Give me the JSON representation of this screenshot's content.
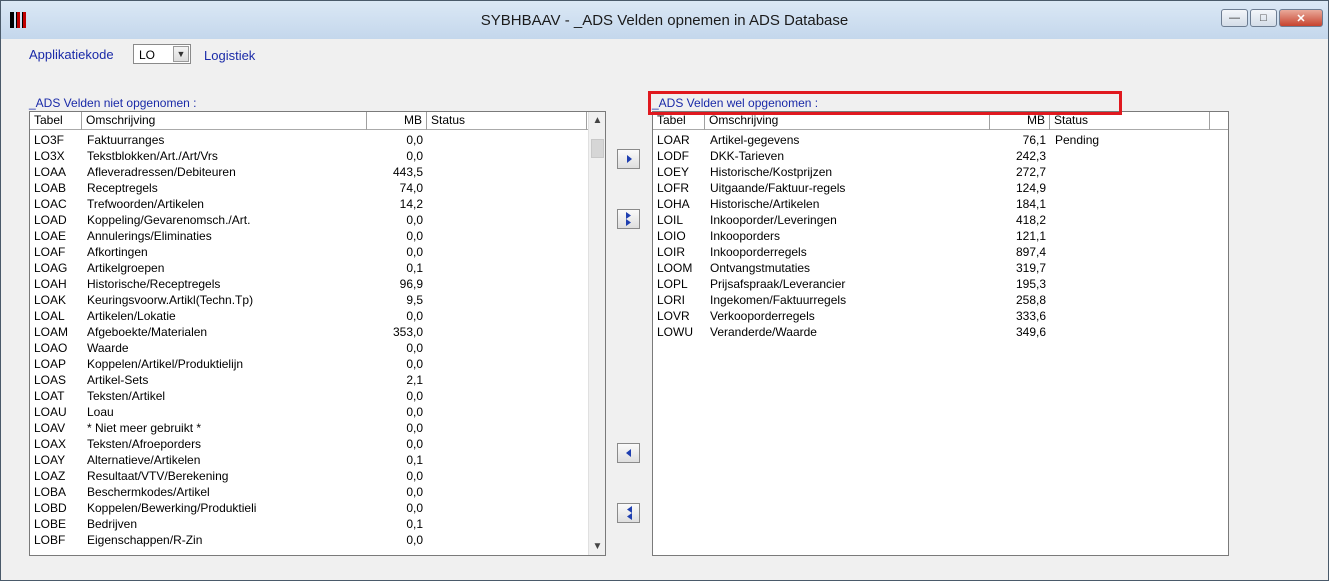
{
  "window": {
    "title": "SYBHBAAV - _ADS Velden opnemen in ADS Database",
    "minimize": "—",
    "maximize": "□",
    "close": "✕"
  },
  "app": {
    "label": "Applikatiekode",
    "code_value": "LO",
    "description": "Logistiek"
  },
  "left": {
    "group_label": "_ADS Velden niet opgenomen :",
    "columns": {
      "tabel": "Tabel",
      "omschrijving": "Omschrijving",
      "mb": "MB",
      "status": "Status"
    },
    "rows": [
      {
        "tabel": "LO3F",
        "oms": "Faktuurranges",
        "mb": "0,0",
        "status": ""
      },
      {
        "tabel": "LO3X",
        "oms": "Tekstblokken/Art./Art/Vrs",
        "mb": "0,0",
        "status": ""
      },
      {
        "tabel": "LOAA",
        "oms": "Afleveradressen/Debiteuren",
        "mb": "443,5",
        "status": ""
      },
      {
        "tabel": "LOAB",
        "oms": "Receptregels",
        "mb": "74,0",
        "status": ""
      },
      {
        "tabel": "LOAC",
        "oms": "Trefwoorden/Artikelen",
        "mb": "14,2",
        "status": ""
      },
      {
        "tabel": "LOAD",
        "oms": "Koppeling/Gevarenomsch./Art.",
        "mb": "0,0",
        "status": ""
      },
      {
        "tabel": "LOAE",
        "oms": "Annulerings/Eliminaties",
        "mb": "0,0",
        "status": ""
      },
      {
        "tabel": "LOAF",
        "oms": "Afkortingen",
        "mb": "0,0",
        "status": ""
      },
      {
        "tabel": "LOAG",
        "oms": "Artikelgroepen",
        "mb": "0,1",
        "status": ""
      },
      {
        "tabel": "LOAH",
        "oms": "Historische/Receptregels",
        "mb": "96,9",
        "status": ""
      },
      {
        "tabel": "LOAK",
        "oms": "Keuringsvoorw.Artikl(Techn.Tp)",
        "mb": "9,5",
        "status": ""
      },
      {
        "tabel": "LOAL",
        "oms": "Artikelen/Lokatie",
        "mb": "0,0",
        "status": ""
      },
      {
        "tabel": "LOAM",
        "oms": "Afgeboekte/Materialen",
        "mb": "353,0",
        "status": ""
      },
      {
        "tabel": "LOAO",
        "oms": "Waarde",
        "mb": "0,0",
        "status": ""
      },
      {
        "tabel": "LOAP",
        "oms": "Koppelen/Artikel/Produktielijn",
        "mb": "0,0",
        "status": ""
      },
      {
        "tabel": "LOAS",
        "oms": "Artikel-Sets",
        "mb": "2,1",
        "status": ""
      },
      {
        "tabel": "LOAT",
        "oms": "Teksten/Artikel",
        "mb": "0,0",
        "status": ""
      },
      {
        "tabel": "LOAU",
        "oms": "Loau",
        "mb": "0,0",
        "status": ""
      },
      {
        "tabel": "LOAV",
        "oms": "* Niet meer gebruikt *",
        "mb": "0,0",
        "status": ""
      },
      {
        "tabel": "LOAX",
        "oms": "Teksten/Afroeporders",
        "mb": "0,0",
        "status": ""
      },
      {
        "tabel": "LOAY",
        "oms": "Alternatieve/Artikelen",
        "mb": "0,1",
        "status": ""
      },
      {
        "tabel": "LOAZ",
        "oms": "Resultaat/VTV/Berekening",
        "mb": "0,0",
        "status": ""
      },
      {
        "tabel": "LOBA",
        "oms": "Beschermkodes/Artikel",
        "mb": "0,0",
        "status": ""
      },
      {
        "tabel": "LOBD",
        "oms": "Koppelen/Bewerking/Produktieli",
        "mb": "0,0",
        "status": ""
      },
      {
        "tabel": "LOBE",
        "oms": "Bedrijven",
        "mb": "0,1",
        "status": ""
      },
      {
        "tabel": "LOBF",
        "oms": "Eigenschappen/R-Zin",
        "mb": "0,0",
        "status": ""
      }
    ]
  },
  "right": {
    "group_label": "_ADS Velden wel opgenomen :",
    "columns": {
      "tabel": "Tabel",
      "omschrijving": "Omschrijving",
      "mb": "MB",
      "status": "Status"
    },
    "rows": [
      {
        "tabel": "LOAR",
        "oms": "Artikel-gegevens",
        "mb": "76,1",
        "status": "Pending"
      },
      {
        "tabel": "LODF",
        "oms": "DKK-Tarieven",
        "mb": "242,3",
        "status": ""
      },
      {
        "tabel": "LOEY",
        "oms": "Historische/Kostprijzen",
        "mb": "272,7",
        "status": ""
      },
      {
        "tabel": "LOFR",
        "oms": "Uitgaande/Faktuur-regels",
        "mb": "124,9",
        "status": ""
      },
      {
        "tabel": "LOHA",
        "oms": "Historische/Artikelen",
        "mb": "184,1",
        "status": ""
      },
      {
        "tabel": "LOIL",
        "oms": "Inkooporder/Leveringen",
        "mb": "418,2",
        "status": ""
      },
      {
        "tabel": "LOIO",
        "oms": "Inkooporders",
        "mb": "121,1",
        "status": ""
      },
      {
        "tabel": "LOIR",
        "oms": "Inkooporderregels",
        "mb": "897,4",
        "status": ""
      },
      {
        "tabel": "LOOM",
        "oms": "Ontvangstmutaties",
        "mb": "319,7",
        "status": ""
      },
      {
        "tabel": "LOPL",
        "oms": "Prijsafspraak/Leverancier",
        "mb": "195,3",
        "status": ""
      },
      {
        "tabel": "LORI",
        "oms": "Ingekomen/Faktuurregels",
        "mb": "258,8",
        "status": ""
      },
      {
        "tabel": "LOVR",
        "oms": "Verkooporderregels",
        "mb": "333,6",
        "status": ""
      },
      {
        "tabel": "LOWU",
        "oms": "Veranderde/Waarde",
        "mb": "349,6",
        "status": ""
      }
    ]
  },
  "colors": {
    "label_blue": "#1a2aa8",
    "highlight_red": "#e0191f"
  },
  "icons": {
    "move_right": "arrow-right-icon",
    "move_all_right": "double-arrow-right-icon",
    "move_left": "arrow-left-icon",
    "move_all_left": "double-arrow-left-icon"
  }
}
